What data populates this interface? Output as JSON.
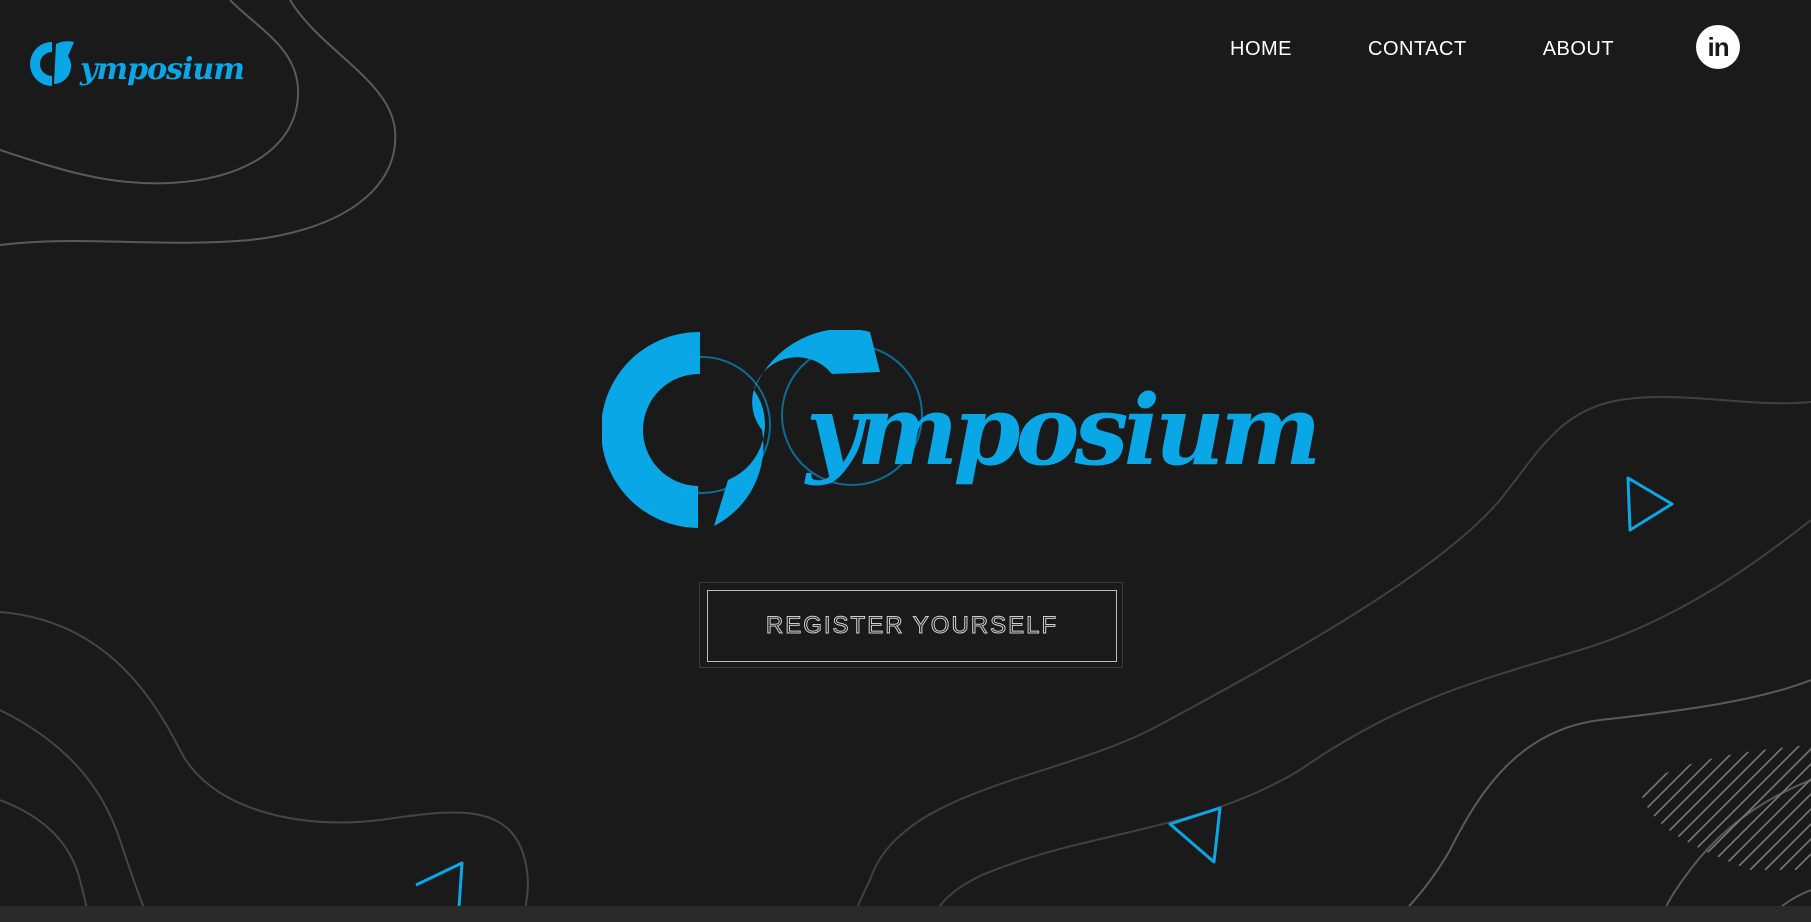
{
  "brand": {
    "name": "Symposium",
    "small_logo_text": "ymposium",
    "hero_logo_text": "ymposium"
  },
  "nav": {
    "items": [
      {
        "label": "HOME"
      },
      {
        "label": "CONTACT"
      },
      {
        "label": "ABOUT"
      }
    ],
    "social_icon": "linkedin-icon",
    "social_label": "in"
  },
  "hero": {
    "cta_label": "REGISTER YOURSELF"
  },
  "colors": {
    "background": "#1a1a1a",
    "accent": "#0aa7e7",
    "text": "#ffffff",
    "contour_lines": "#5a5a5a"
  }
}
